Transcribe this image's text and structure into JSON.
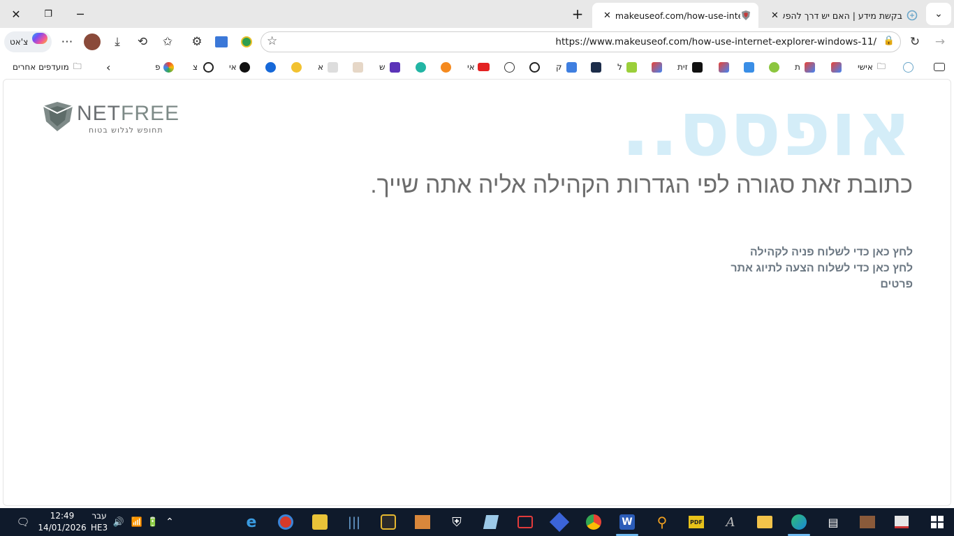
{
  "tabs": [
    {
      "title": "makeuseof.com/how-use-internet-",
      "active": true
    },
    {
      "title": "בקשת מידע | האם יש דרך להפעיל",
      "active": false
    }
  ],
  "nav": {
    "url": "https://www.makeuseof.com/how-use-internet-explorer-windows-11/",
    "profile_label": "צ'אט"
  },
  "favorites": {
    "other_favorites": "מועדפים אחרים",
    "personal": "אישי",
    "items": [
      "פ",
      "צ",
      "אי",
      "א",
      "ש",
      "אי",
      "ק",
      "ל",
      "זית",
      "ת"
    ]
  },
  "page": {
    "headline": "אופסס..",
    "subtitle": "כתובת זאת סגורה לפי הגדרות הקהילה אליה אתה שייך.",
    "links": [
      "לחץ כאן כדי לשלוח פניה לקהילה",
      "לחץ כאן כדי לשלוח הצעה לתיוג אתר",
      "פרטים"
    ],
    "logo_text_a": "NET",
    "logo_text_b": "FREE",
    "logo_tagline": "תחופש לגלוש בטוח"
  },
  "taskbar": {
    "time": "12:49",
    "date": "14/01/2026",
    "lang": "עבר",
    "lang_code": "HE3"
  }
}
